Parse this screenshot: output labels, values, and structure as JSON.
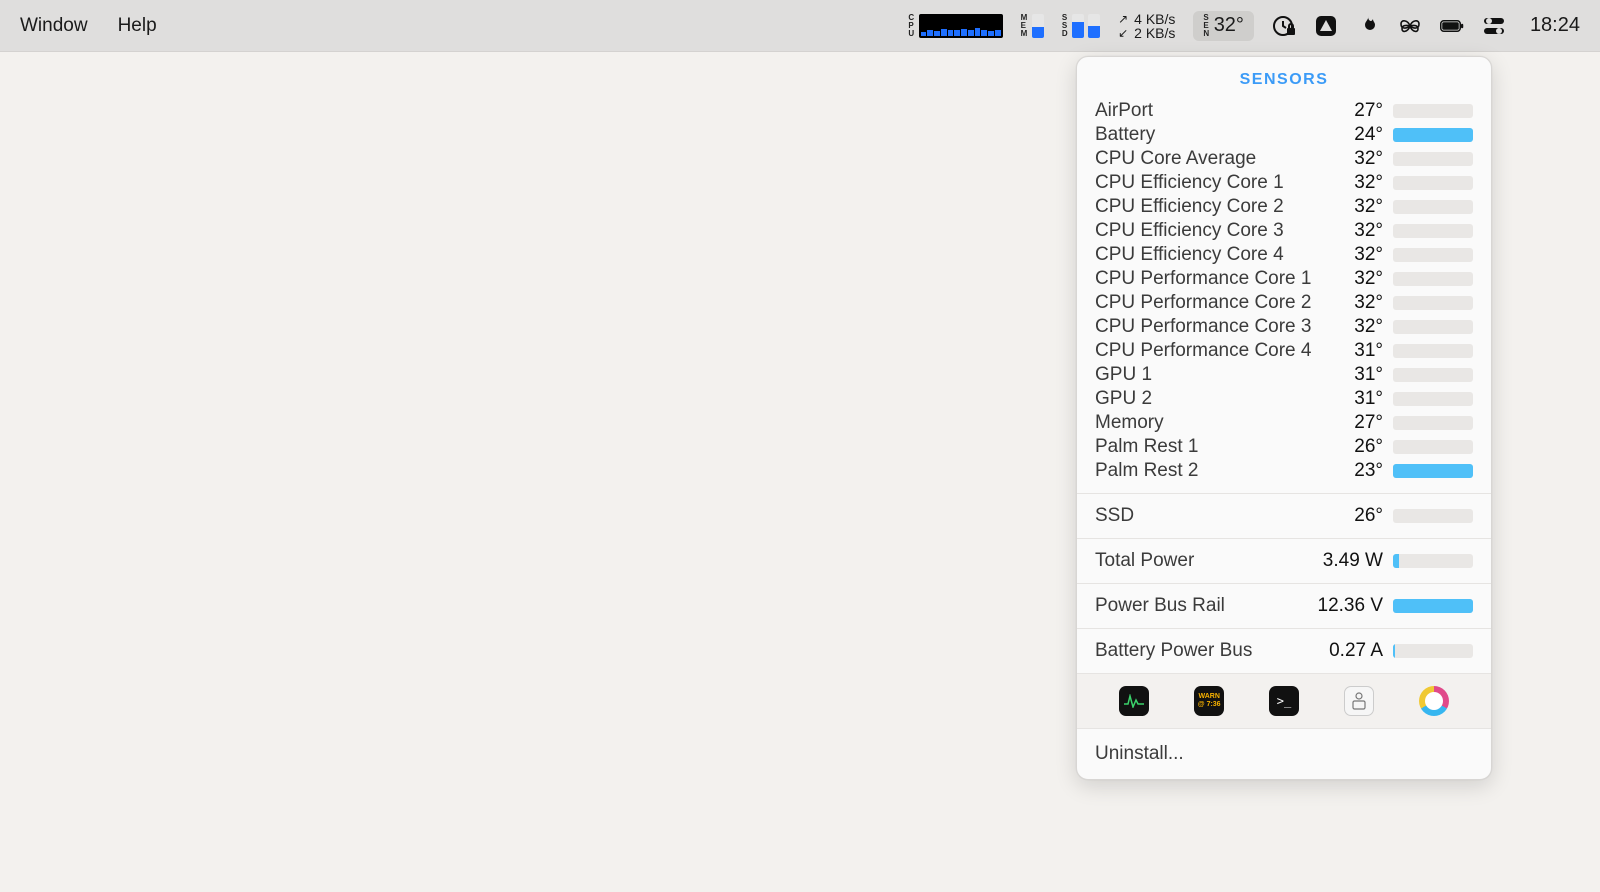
{
  "menubar": {
    "items": [
      "Window",
      "Help"
    ],
    "cpu_label_chars": [
      "C",
      "P",
      "U"
    ],
    "mem_label_chars": [
      "M",
      "E",
      "M"
    ],
    "ssd_label_chars": [
      "S",
      "S",
      "D"
    ],
    "sen_label_chars": [
      "S",
      "E",
      "N"
    ],
    "net_up": "4 KB/s",
    "net_down": "2 KB/s",
    "sensor_temp": "32°",
    "clock": "18:24"
  },
  "panel": {
    "title": "SENSORS",
    "sensors": [
      {
        "label": "AirPort",
        "value": "27°",
        "fill": 0
      },
      {
        "label": "Battery",
        "value": "24°",
        "fill": 100
      },
      {
        "label": "CPU Core Average",
        "value": "32°",
        "fill": 0
      },
      {
        "label": "CPU Efficiency Core 1",
        "value": "32°",
        "fill": 0
      },
      {
        "label": "CPU Efficiency Core 2",
        "value": "32°",
        "fill": 0
      },
      {
        "label": "CPU Efficiency Core 3",
        "value": "32°",
        "fill": 0
      },
      {
        "label": "CPU Efficiency Core 4",
        "value": "32°",
        "fill": 0
      },
      {
        "label": "CPU Performance Core 1",
        "value": "32°",
        "fill": 0
      },
      {
        "label": "CPU Performance Core 2",
        "value": "32°",
        "fill": 0
      },
      {
        "label": "CPU Performance Core 3",
        "value": "32°",
        "fill": 0
      },
      {
        "label": "CPU Performance Core 4",
        "value": "31°",
        "fill": 0
      },
      {
        "label": "GPU 1",
        "value": "31°",
        "fill": 0
      },
      {
        "label": "GPU 2",
        "value": "31°",
        "fill": 0
      },
      {
        "label": "Memory",
        "value": "27°",
        "fill": 0
      },
      {
        "label": "Palm Rest 1",
        "value": "26°",
        "fill": 0
      },
      {
        "label": "Palm Rest 2",
        "value": "23°",
        "fill": 100
      }
    ],
    "ssd": {
      "label": "SSD",
      "value": "26°",
      "fill": 0
    },
    "power": {
      "label": "Total Power",
      "value": "3.49 W",
      "fill": 8
    },
    "rail": {
      "label": "Power Bus Rail",
      "value": "12.36 V",
      "fill": 100
    },
    "batt": {
      "label": "Battery Power Bus",
      "value": "0.27 A",
      "fill": 3
    },
    "uninstall": "Uninstall..."
  }
}
